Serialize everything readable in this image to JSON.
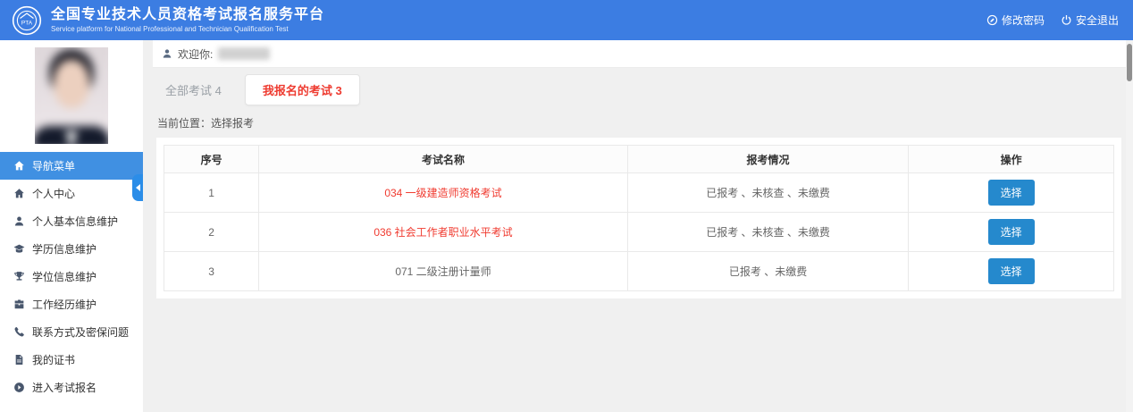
{
  "header": {
    "title": "全国专业技术人员资格考试报名服务平台",
    "subtitle": "Service platform for National Professional and Technician Qualification Test",
    "change_password_label": "修改密码",
    "logout_label": "安全退出",
    "logo_text": "PTA"
  },
  "sidebar": {
    "menu": [
      {
        "label": "导航菜单",
        "icon": "home-icon",
        "active": true
      },
      {
        "label": "个人中心",
        "icon": "house-icon",
        "active": false
      },
      {
        "label": "个人基本信息维护",
        "icon": "user-icon",
        "active": false
      },
      {
        "label": "学历信息维护",
        "icon": "graduation-cap-icon",
        "active": false
      },
      {
        "label": "学位信息维护",
        "icon": "trophy-icon",
        "active": false
      },
      {
        "label": "工作经历维护",
        "icon": "briefcase-icon",
        "active": false
      },
      {
        "label": "联系方式及密保问题",
        "icon": "phone-icon",
        "active": false
      },
      {
        "label": "我的证书",
        "icon": "certificate-icon",
        "active": false
      },
      {
        "label": "进入考试报名",
        "icon": "arrow-circle-icon",
        "active": false
      }
    ]
  },
  "main": {
    "welcome_label": "欢迎你:",
    "tabs": [
      {
        "label": "全部考试 4",
        "active": false
      },
      {
        "label": "我报名的考试 3",
        "active": true
      }
    ],
    "breadcrumb": "当前位置：选择报考",
    "table": {
      "headers": [
        "序号",
        "考试名称",
        "报考情况",
        "操作"
      ],
      "rows": [
        {
          "no": "1",
          "name": "034 一级建造师资格考试",
          "status": "已报考 、未核查 、未缴费",
          "action": "选择"
        },
        {
          "no": "2",
          "name": "036 社会工作者职业水平考试",
          "status": "已报考 、未核查 、未缴费",
          "action": "选择"
        },
        {
          "no": "3",
          "name": "071 二级注册计量师",
          "status": "已报考 、未缴费",
          "action": "选择"
        }
      ]
    }
  },
  "colors": {
    "header_blue": "#3c7de2",
    "active_menu_blue": "#4090e2",
    "button_blue": "#2589cd",
    "highlight_red": "#f03b30",
    "page_background": "#f0f0f0"
  }
}
